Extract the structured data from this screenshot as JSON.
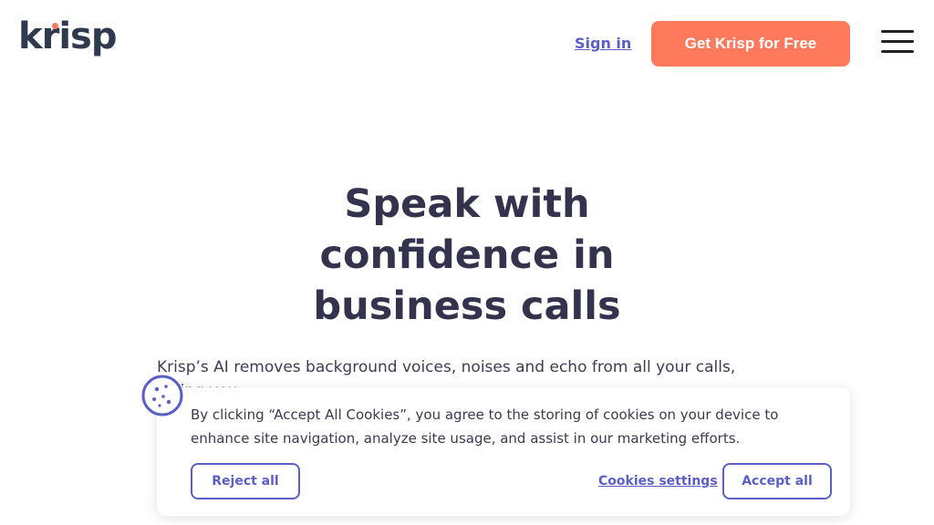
{
  "header": {
    "logo_text": "krisp",
    "signin_label": "Sign in",
    "cta_label": "Get Krisp for Free",
    "menu_icon": "hamburger-menu-icon"
  },
  "hero": {
    "title": "Speak with confidence in business calls",
    "subtitle": "Krisp’s AI removes background voices, noises and echo from all your calls, giving you"
  },
  "cookie_banner": {
    "icon": "cookie-icon",
    "text": "By clicking “Accept All Cookies”, you agree to the storing of cookies on your device to enhance site navigation, analyze site usage, and assist in our marketing efforts.",
    "reject_label": "Reject all",
    "settings_label": "Cookies settings",
    "accept_label": "Accept all"
  },
  "colors": {
    "accent": "#ff7a5c",
    "link": "#5a5fc8",
    "heading": "#33334d"
  }
}
